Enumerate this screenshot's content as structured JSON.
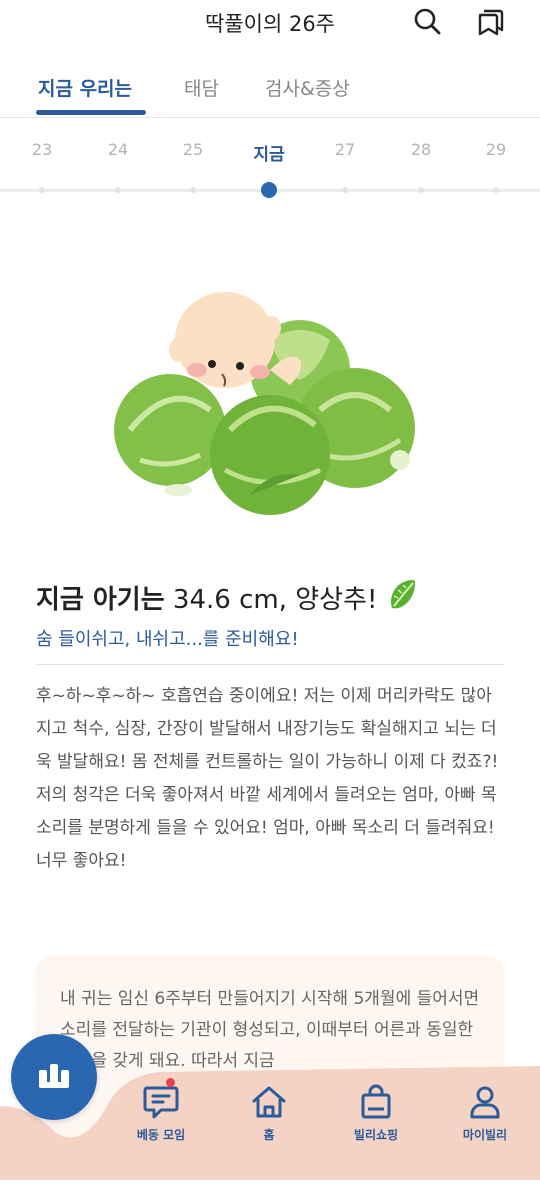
{
  "header": {
    "title": "딱풀이의 26주",
    "search_icon": "search-icon",
    "book_icon": "bookmark-pages-icon"
  },
  "tabs": [
    {
      "label": "지금 우리는",
      "active": true
    },
    {
      "label": "태담",
      "active": false
    },
    {
      "label": "검사&증상",
      "active": false
    }
  ],
  "weeks": [
    {
      "label": "23",
      "current": false
    },
    {
      "label": "24",
      "current": false
    },
    {
      "label": "25",
      "current": false
    },
    {
      "label": "지금",
      "current": true
    },
    {
      "label": "27",
      "current": false
    },
    {
      "label": "28",
      "current": false
    },
    {
      "label": "29",
      "current": false
    }
  ],
  "baby": {
    "lead": "지금 아기는",
    "size": "34.6 cm, 양상추!",
    "subtitle": "숨 들이쉬고, 내쉬고...를 준비해요!",
    "description": [
      "후~하~후~하~ 호흡연습 중이에요! 저는 이제 머리카락도 많아지고 척수, 심장, 간장이 발달해서 내장기능도 확실해지고 뇌는 더욱 발달해요! 몸 전체를 컨트롤하는 일이 가능하니 이제 다 컸죠?!",
      "저의 청각은 더욱 좋아져서 바깥 세계에서 들려오는 엄마, 아빠 목소리를 분명하게 들을 수 있어요! 엄마, 아빠 목소리 더 들려줘요! 너무 좋아요!"
    ]
  },
  "card": {
    "text": "내 귀는 임신 6주부터 만들어지기 시작해 5개월에 들어서면 소리를 전달하는 기관이 형성되고, 이때부터 어른과 동일한 청각을 갖게 돼요. 따라서 지금"
  },
  "nav": {
    "items": [
      {
        "label": "베동 모임",
        "icon": "chat-icon",
        "badge": true
      },
      {
        "label": "홈",
        "icon": "home-icon",
        "badge": false
      },
      {
        "label": "빌리쇼핑",
        "icon": "shopping-bag-icon",
        "badge": false
      },
      {
        "label": "마이빌리",
        "icon": "person-icon",
        "badge": false
      }
    ],
    "fab_icon": "billy-logo-icon"
  },
  "colors": {
    "accent": "#2a5b9c",
    "nav_bg": "#f5d3c4",
    "card_bg": "#fdf6f1",
    "badge": "#e8404b"
  }
}
